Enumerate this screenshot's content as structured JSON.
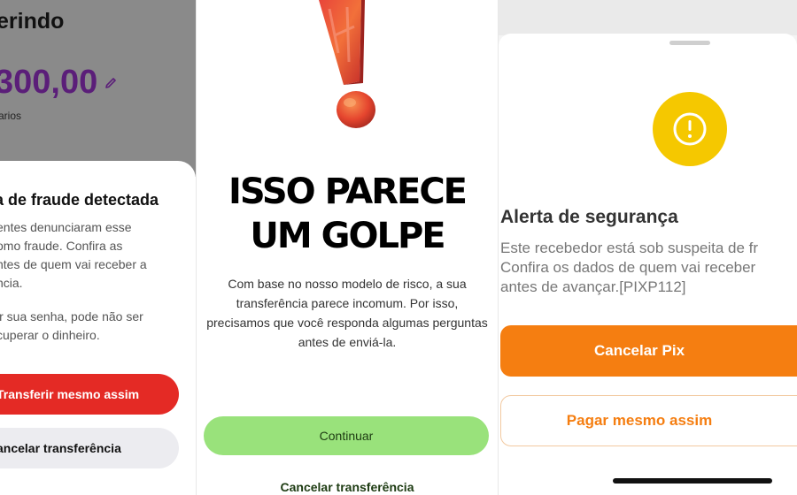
{
  "panel1": {
    "title": "erindo",
    "amount": "300,00",
    "sub_label": "arios",
    "alert_title": "a de fraude detectada",
    "body_lines": "entes denunciaram esse\nomo fraude. Confira as\nntes de quem vai receber a\nncia.",
    "body2_lines": "ir sua senha, pode não ser\ncuperar o dinheiro.",
    "transfer_anyway_label": "Transferir mesmo assim",
    "cancel_label": "ancelar transferência",
    "colors": {
      "accent_purple": "#5b1e79",
      "danger_red": "#e42a25"
    },
    "icons": {
      "edit": "pencil-icon"
    }
  },
  "panel2": {
    "headline": "ISSO PARECE UM GOLPE",
    "description": "Com base no nosso modelo de risco, a sua transferência parece incomum. Por isso, precisamos que você responda algumas perguntas antes de enviá-la.",
    "continue_label": "Continuar",
    "cancel_label": "Cancelar transferência",
    "colors": {
      "primary_green": "#99e27b",
      "text_dark_green": "#1d3b12"
    },
    "icons": {
      "hero": "exclamation-icon"
    }
  },
  "panel3": {
    "alert_title": "Alerta de segurança",
    "body_lines": "Este recebedor está sob suspeita de fr\nConfira os dados de quem vai receber\nantes de avançar.[PIXP112]",
    "cancel_label": "Cancelar Pix",
    "pay_anyway_label": "Pagar mesmo assim",
    "colors": {
      "primary_orange": "#f57e11",
      "warning_yellow": "#f5c800"
    },
    "icons": {
      "warning": "warning-circle-icon"
    }
  }
}
